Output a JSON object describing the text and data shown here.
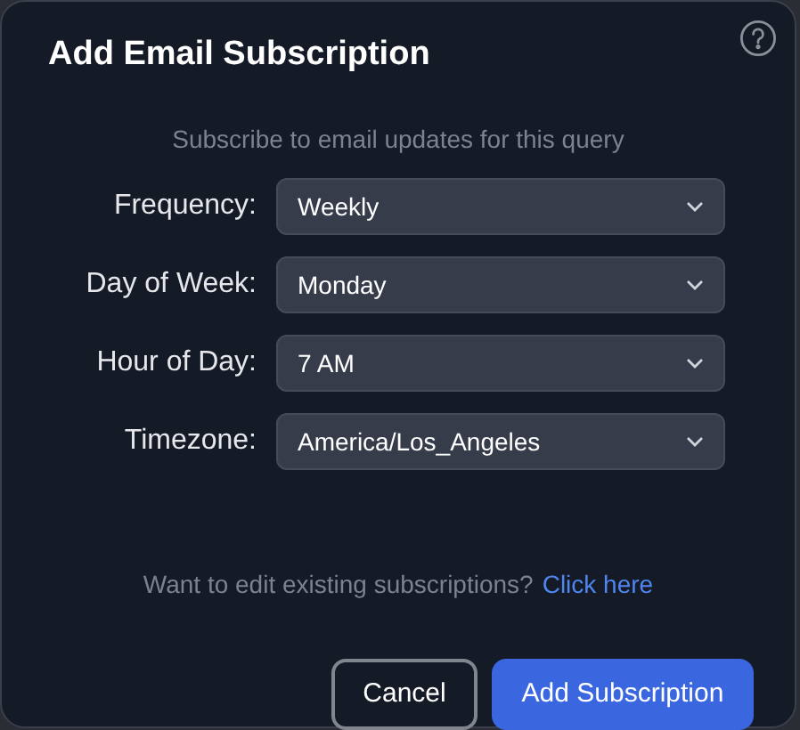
{
  "dialog": {
    "title": "Add Email Subscription",
    "subtitle": "Subscribe to email updates for this query"
  },
  "fields": [
    {
      "label": "Frequency:",
      "value": "Weekly"
    },
    {
      "label": "Day of Week:",
      "value": "Monday"
    },
    {
      "label": "Hour of Day:",
      "value": "7 AM"
    },
    {
      "label": "Timezone:",
      "value": "America/Los_Angeles"
    }
  ],
  "edit_prompt": {
    "text": "Want to edit existing subscriptions?",
    "link": "Click here"
  },
  "buttons": {
    "cancel": "Cancel",
    "submit": "Add Subscription"
  }
}
